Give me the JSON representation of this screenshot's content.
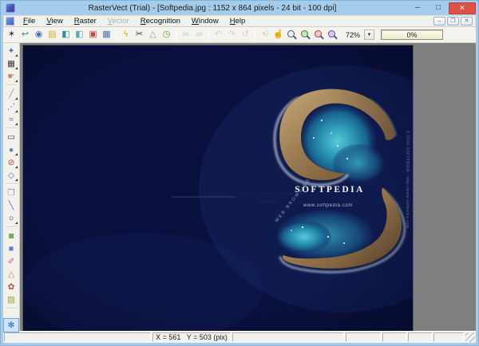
{
  "window": {
    "title": "RasterVect (Trial) - [Softpedia.jpg : 1152 x 864 pixels - 24 bit - 100 dpi]",
    "controls": {
      "minimize": "–",
      "maximize": "□",
      "close": "✕"
    },
    "child_controls": {
      "minimize": "–",
      "restore": "❐",
      "close": "✕"
    }
  },
  "menu": {
    "items": [
      {
        "label": "File",
        "enabled": true
      },
      {
        "label": "View",
        "enabled": true
      },
      {
        "label": "Raster",
        "enabled": true
      },
      {
        "label": "Vector",
        "enabled": false
      },
      {
        "label": "Recognition",
        "enabled": true
      },
      {
        "label": "Window",
        "enabled": true
      },
      {
        "label": "Help",
        "enabled": true
      }
    ]
  },
  "toolbar": {
    "zoom_value": "72%",
    "dropdown_glyph": "▼",
    "progress": "0%",
    "groups": [
      {
        "buttons": [
          {
            "name": "wizard",
            "glyph": "✶",
            "cls": "c-dark"
          },
          {
            "name": "import",
            "glyph": "↩",
            "cls": "c-teal"
          },
          {
            "name": "acquire",
            "glyph": "◉",
            "cls": "c-blue"
          },
          {
            "name": "open-folder",
            "glyph": "▤",
            "cls": "c-yellow"
          },
          {
            "name": "save",
            "glyph": "◧",
            "cls": "c-teal"
          },
          {
            "name": "save-as",
            "glyph": "◧",
            "cls": "c-teal2"
          },
          {
            "name": "help-book",
            "glyph": "▣",
            "cls": "c-red"
          },
          {
            "name": "print",
            "glyph": "▦",
            "cls": "c-blue"
          }
        ]
      },
      {
        "buttons": [
          {
            "name": "recognize-lightning",
            "glyph": "ϟ",
            "cls": "c-gold"
          },
          {
            "name": "cut-scissors",
            "glyph": "✂",
            "cls": "c-dark"
          },
          {
            "name": "measure-triangle",
            "glyph": "△",
            "cls": "c-gray"
          },
          {
            "name": "timer-clock",
            "glyph": "◷",
            "cls": "c-green"
          }
        ]
      },
      {
        "buttons": [
          {
            "name": "find-binoculars",
            "glyph": "∞",
            "cls": "c-disabled"
          },
          {
            "name": "find-next-binoculars",
            "glyph": "∞",
            "cls": "c-disabled"
          }
        ]
      },
      {
        "buttons": [
          {
            "name": "undo",
            "glyph": "↶",
            "cls": "c-disabled2"
          },
          {
            "name": "redo",
            "glyph": "↷",
            "cls": "c-disabled2"
          },
          {
            "name": "repeat",
            "glyph": "↺",
            "cls": "c-disabled2"
          }
        ]
      },
      {
        "buttons": [
          {
            "name": "pan-hand",
            "glyph": "☜",
            "cls": "c-hand"
          },
          {
            "name": "pick-hand",
            "glyph": "☝",
            "cls": "c-hand"
          },
          {
            "name": "zoom",
            "glyph": "",
            "cls": "mag"
          },
          {
            "name": "zoom-in",
            "glyph": "",
            "cls": "mag mag-green"
          },
          {
            "name": "zoom-out",
            "glyph": "",
            "cls": "mag mag-red"
          },
          {
            "name": "zoom-window",
            "glyph": "",
            "cls": "mag mag-purple"
          }
        ]
      }
    ]
  },
  "side_toolbar": {
    "items": [
      {
        "name": "select",
        "glyph": "✦",
        "cls": "c-blue",
        "fly": true
      },
      {
        "name": "raster-grid",
        "glyph": "▦",
        "cls": "c-dark",
        "fly": true
      },
      {
        "name": "grab-hand",
        "glyph": "☛",
        "cls": "c-hand",
        "fly": true
      },
      {
        "sep": true
      },
      {
        "name": "line",
        "glyph": "╱",
        "cls": "c-gray",
        "fly": true
      },
      {
        "name": "polyline",
        "glyph": "⋰",
        "cls": "c-blue",
        "fly": true
      },
      {
        "name": "curve",
        "glyph": "≈",
        "cls": "c-blue",
        "fly": true
      },
      {
        "sep": true
      },
      {
        "name": "rectangle",
        "glyph": "▭",
        "cls": "c-dark"
      },
      {
        "name": "sphere",
        "glyph": "●",
        "cls": "c-blue2",
        "fly": true
      },
      {
        "name": "forbid",
        "glyph": "⊘",
        "cls": "c-red",
        "fly": true
      },
      {
        "name": "shape",
        "glyph": "◇",
        "cls": "c-blue",
        "fly": true
      },
      {
        "sep": true
      },
      {
        "name": "page",
        "glyph": "❐",
        "cls": "c-gray"
      },
      {
        "name": "line-2",
        "glyph": "╲",
        "cls": "c-blue"
      },
      {
        "name": "ellipse",
        "glyph": "○",
        "cls": "c-dark",
        "fly": true
      },
      {
        "sep": true
      },
      {
        "name": "bucket",
        "glyph": "◙",
        "cls": "c-green"
      },
      {
        "name": "fill-square",
        "glyph": "■",
        "cls": "c-blue2"
      },
      {
        "name": "pen",
        "glyph": "✐",
        "cls": "c-pink"
      },
      {
        "name": "polygon",
        "glyph": "△",
        "cls": "c-tan"
      },
      {
        "name": "brush",
        "glyph": "✿",
        "cls": "c-red"
      },
      {
        "name": "hatch",
        "glyph": "▨",
        "cls": "c-olive"
      },
      {
        "sep": true
      },
      {
        "name": "snap-star",
        "glyph": "✻",
        "cls": "c-royal",
        "active": true
      }
    ]
  },
  "canvas": {
    "image": {
      "brand": "SOFTPEDIA",
      "url": "www.softpedia.com",
      "slogan": "WEB BROWSING",
      "edge_credit": "© 2008 SOFTPEDIA - http://www.softpedia.com"
    }
  },
  "statusbar": {
    "coords": "X = 561   Y = 503 (pix)"
  },
  "colors": {
    "titlebar": "#a5cdeb",
    "close_red": "#dd5149",
    "chrome": "#f4f3ee",
    "canvas_gray": "#7f7f7f",
    "sea_navy": "#0a103e",
    "lagoon_teal": "#2f9cb8",
    "island_sand": "#9a7a50",
    "active_tool_blue": "#2b5fd0"
  }
}
